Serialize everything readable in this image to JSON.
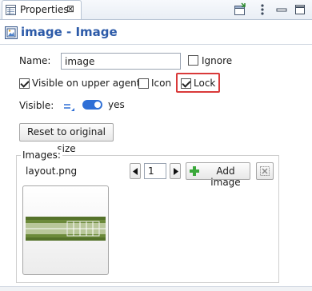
{
  "tab": {
    "label": "Properties",
    "close_glyph": "⊠"
  },
  "header": {
    "title": "image - Image"
  },
  "form": {
    "name_label": "Name:",
    "name_value": "image",
    "ignore_label": "Ignore",
    "visible_on_upper_agent_label": "Visible on upper agent",
    "icon_label": "Icon",
    "lock_label": "Lock",
    "visible_label": "Visible:",
    "visible_value": "yes",
    "reset_button_label": "Reset to original size"
  },
  "images": {
    "group_label": "Images:",
    "file_name": "layout.png",
    "current_index": "1",
    "add_image_label": "Add image"
  },
  "state": {
    "ignore_checked": false,
    "visible_on_upper_agent_checked": true,
    "icon_checked": false,
    "lock_checked": true,
    "visible_toggle_on": true
  },
  "colors": {
    "title_blue": "#2c5aa8",
    "highlight_red": "#d93a3a",
    "toggle_blue": "#2f6fd6",
    "add_green": "#3aa83a",
    "thumb_green": "#6c8a3a"
  }
}
